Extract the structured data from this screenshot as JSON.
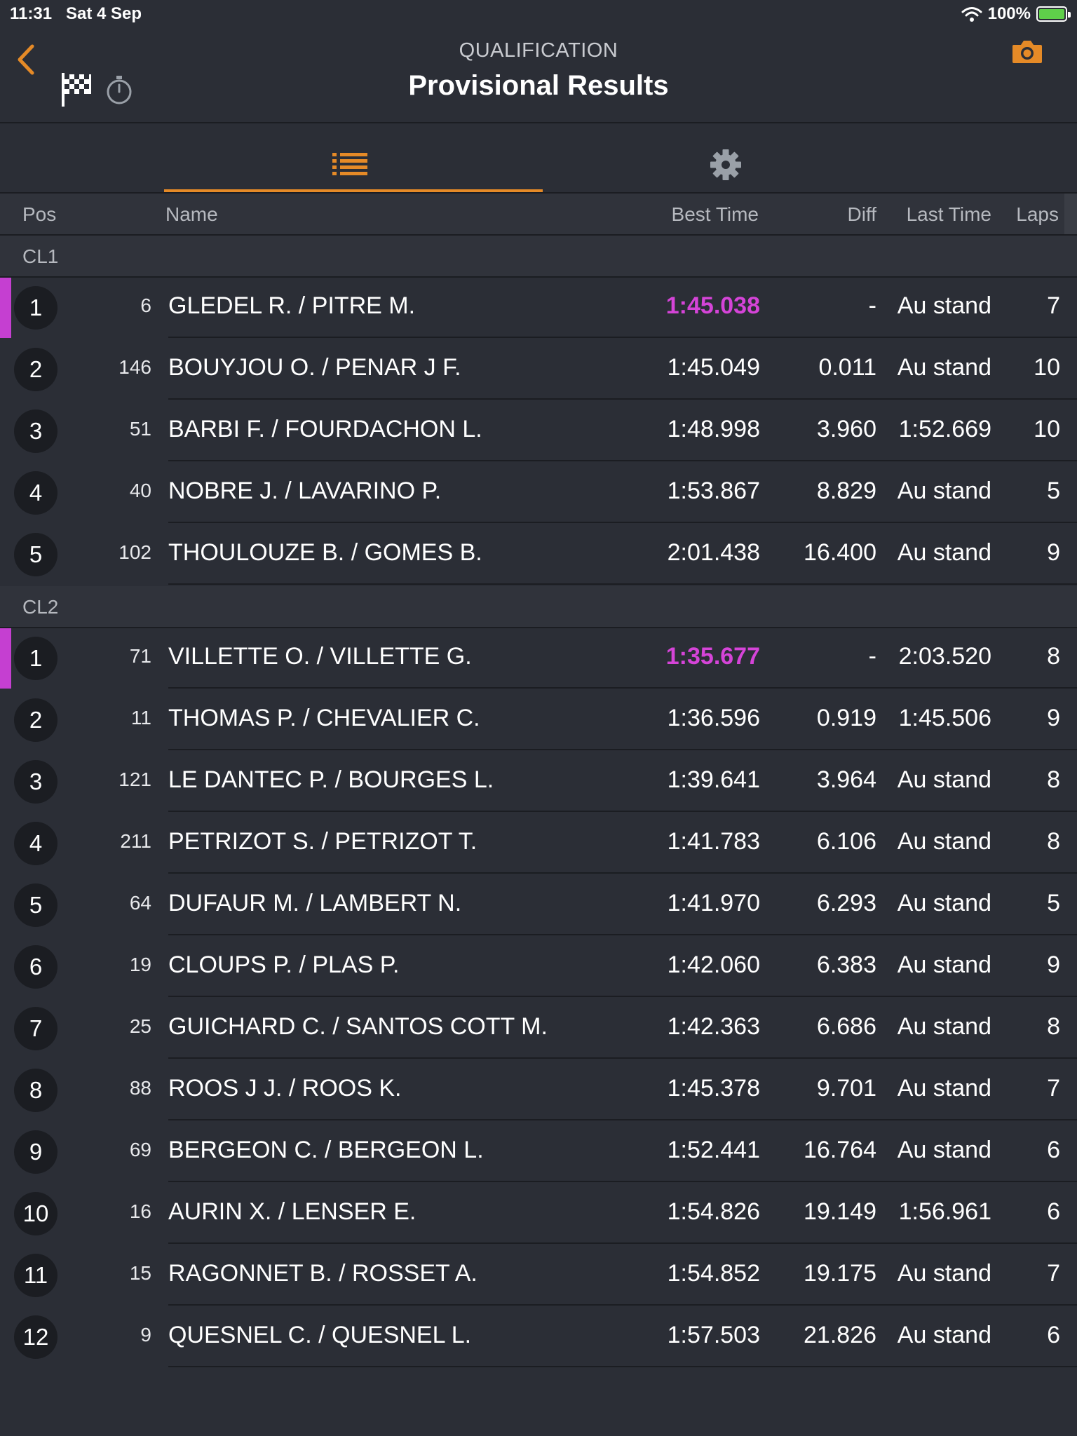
{
  "status": {
    "time": "11:31",
    "date": "Sat 4 Sep",
    "battery": "100%"
  },
  "header": {
    "subtitle": "QUALIFICATION",
    "title": "Provisional Results"
  },
  "columns": {
    "pos": "Pos",
    "name": "Name",
    "best": "Best Time",
    "diff": "Diff",
    "last": "Last Time",
    "laps": "Laps"
  },
  "colors": {
    "accent": "#e58a27",
    "purple": "#d544d8",
    "background": "#2b2e36"
  },
  "icons": {
    "back": "chevron-left-icon",
    "flag": "checkered-flag-icon",
    "timer": "stopwatch-icon",
    "camera": "camera-icon",
    "list": "list-icon",
    "settings": "gear-icon"
  },
  "groups": [
    {
      "name": "CL1",
      "rows": [
        {
          "pos": "1",
          "num": "6",
          "name": "GLEDEL R. / PITRE M.",
          "best": "1:45.038",
          "diff": "-",
          "last": "Au stand",
          "laps": "7",
          "leader": true
        },
        {
          "pos": "2",
          "num": "146",
          "name": "BOUYJOU O. / PENAR J F.",
          "best": "1:45.049",
          "diff": "0.011",
          "last": "Au stand",
          "laps": "10"
        },
        {
          "pos": "3",
          "num": "51",
          "name": "BARBI F. / FOURDACHON L.",
          "best": "1:48.998",
          "diff": "3.960",
          "last": "1:52.669",
          "laps": "10"
        },
        {
          "pos": "4",
          "num": "40",
          "name": "NOBRE J. / LAVARINO P.",
          "best": "1:53.867",
          "diff": "8.829",
          "last": "Au stand",
          "laps": "5"
        },
        {
          "pos": "5",
          "num": "102",
          "name": "THOULOUZE B. / GOMES B.",
          "best": "2:01.438",
          "diff": "16.400",
          "last": "Au stand",
          "laps": "9"
        }
      ]
    },
    {
      "name": "CL2",
      "rows": [
        {
          "pos": "1",
          "num": "71",
          "name": "VILLETTE O. / VILLETTE G.",
          "best": "1:35.677",
          "diff": "-",
          "last": "2:03.520",
          "laps": "8",
          "leader": true
        },
        {
          "pos": "2",
          "num": "11",
          "name": "THOMAS P. / CHEVALIER C.",
          "best": "1:36.596",
          "diff": "0.919",
          "last": "1:45.506",
          "laps": "9"
        },
        {
          "pos": "3",
          "num": "121",
          "name": "LE DANTEC P. / BOURGES L.",
          "best": "1:39.641",
          "diff": "3.964",
          "last": "Au stand",
          "laps": "8"
        },
        {
          "pos": "4",
          "num": "211",
          "name": "PETRIZOT S. / PETRIZOT T.",
          "best": "1:41.783",
          "diff": "6.106",
          "last": "Au stand",
          "laps": "8"
        },
        {
          "pos": "5",
          "num": "64",
          "name": "DUFAUR M. / LAMBERT N.",
          "best": "1:41.970",
          "diff": "6.293",
          "last": "Au stand",
          "laps": "5"
        },
        {
          "pos": "6",
          "num": "19",
          "name": "CLOUPS P. / PLAS P.",
          "best": "1:42.060",
          "diff": "6.383",
          "last": "Au stand",
          "laps": "9"
        },
        {
          "pos": "7",
          "num": "25",
          "name": "GUICHARD C. / SANTOS COTT M.",
          "best": "1:42.363",
          "diff": "6.686",
          "last": "Au stand",
          "laps": "8"
        },
        {
          "pos": "8",
          "num": "88",
          "name": "ROOS J J. / ROOS K.",
          "best": "1:45.378",
          "diff": "9.701",
          "last": "Au stand",
          "laps": "7"
        },
        {
          "pos": "9",
          "num": "69",
          "name": "BERGEON C. / BERGEON L.",
          "best": "1:52.441",
          "diff": "16.764",
          "last": "Au stand",
          "laps": "6"
        },
        {
          "pos": "10",
          "num": "16",
          "name": "AURIN X. / LENSER E.",
          "best": "1:54.826",
          "diff": "19.149",
          "last": "1:56.961",
          "laps": "6"
        },
        {
          "pos": "11",
          "num": "15",
          "name": "RAGONNET B. / ROSSET A.",
          "best": "1:54.852",
          "diff": "19.175",
          "last": "Au stand",
          "laps": "7"
        },
        {
          "pos": "12",
          "num": "9",
          "name": "QUESNEL C. / QUESNEL L.",
          "best": "1:57.503",
          "diff": "21.826",
          "last": "Au stand",
          "laps": "6"
        }
      ]
    }
  ]
}
